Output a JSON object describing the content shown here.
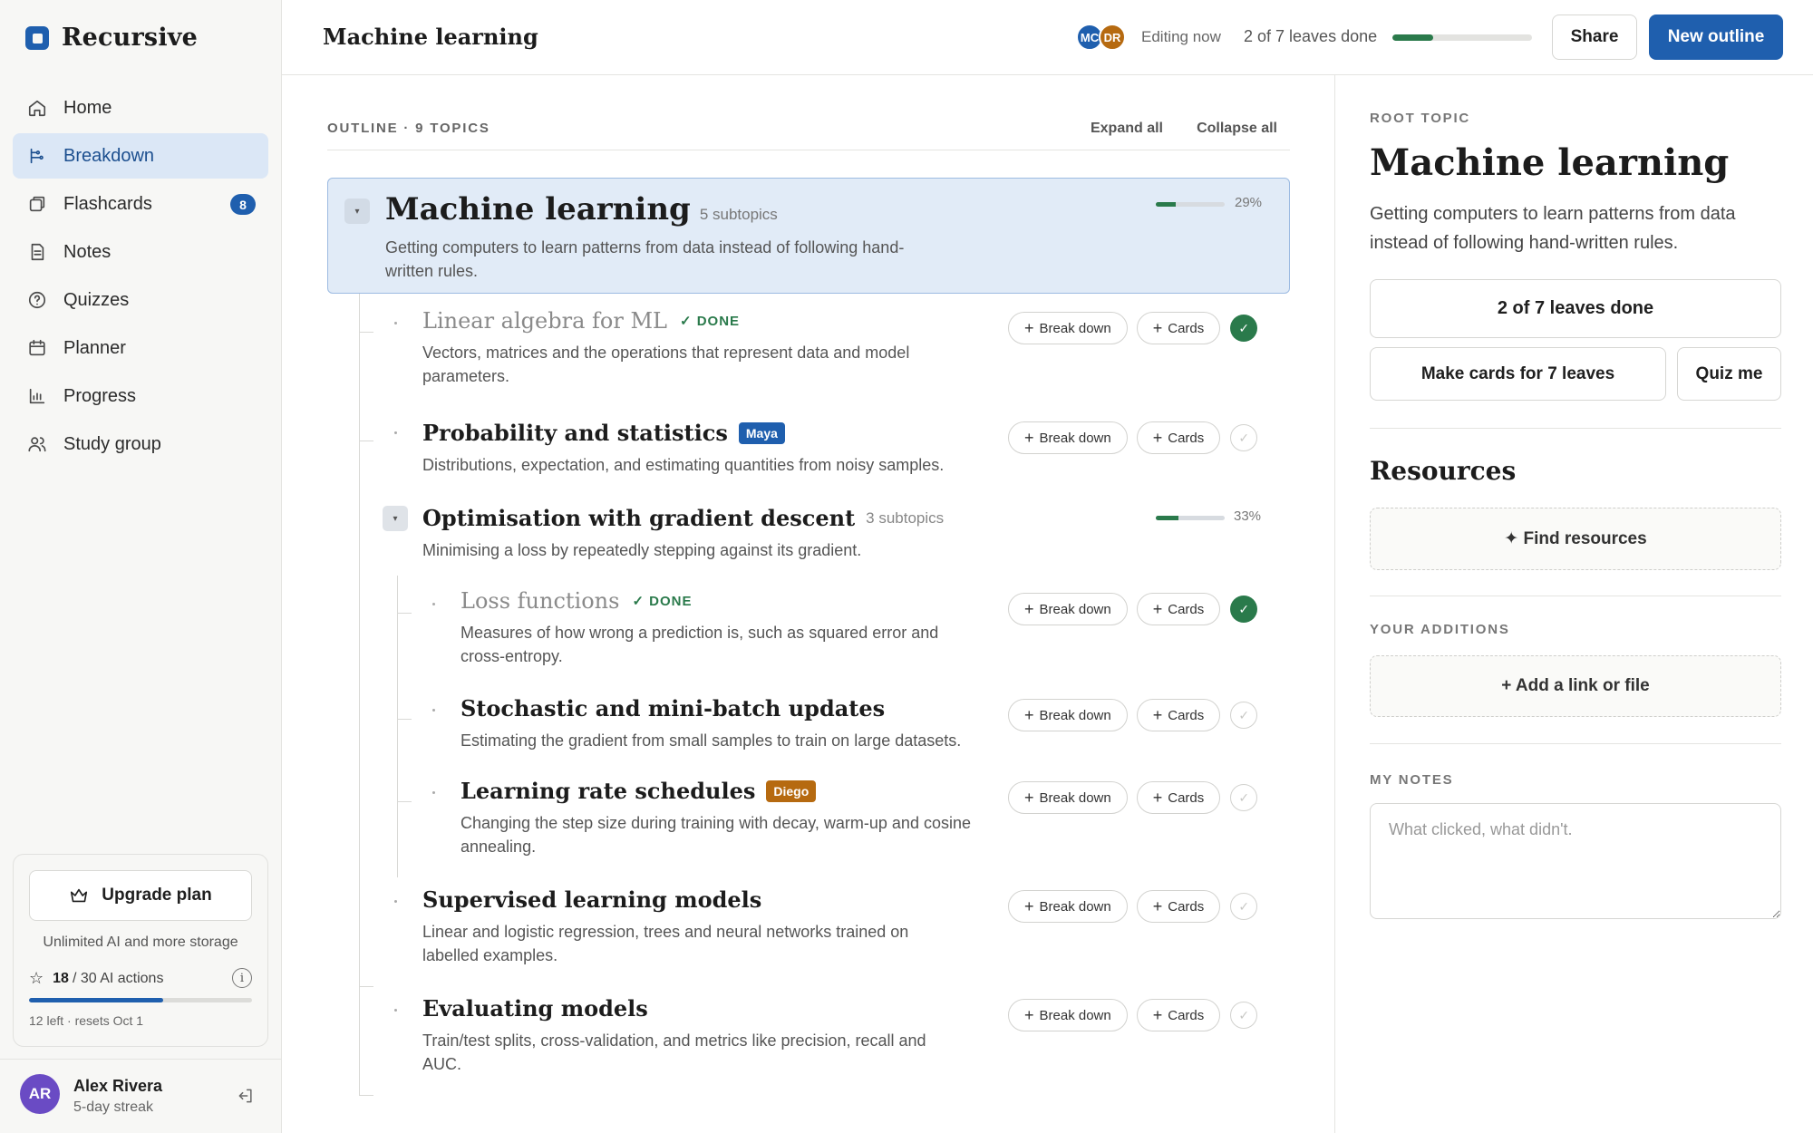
{
  "app": {
    "name": "Recursive"
  },
  "sidebar": {
    "items": [
      {
        "label": "Home",
        "icon": "home-icon"
      },
      {
        "label": "Breakdown",
        "icon": "breakdown-icon",
        "active": true
      },
      {
        "label": "Flashcards",
        "icon": "flashcards-icon",
        "badge": "8"
      },
      {
        "label": "Notes",
        "icon": "notes-icon"
      },
      {
        "label": "Quizzes",
        "icon": "quizzes-icon"
      },
      {
        "label": "Planner",
        "icon": "calendar-icon"
      },
      {
        "label": "Progress",
        "icon": "bar-chart-icon"
      },
      {
        "label": "Study group",
        "icon": "users-icon"
      }
    ],
    "upgrade": {
      "button_label": "Upgrade plan",
      "subtitle": "Unlimited AI and more storage",
      "ai_used": "18",
      "ai_total_text": "/ 30 AI actions",
      "ai_fraction": 0.6,
      "left_text": "12 left · resets Oct 1"
    },
    "user": {
      "initials": "AR",
      "name": "Alex Rivera",
      "streak": "5-day streak"
    }
  },
  "header": {
    "title": "Machine learning",
    "collaborators": [
      "MC",
      "DR"
    ],
    "editing_text": "Editing now",
    "leaves_done_text": "2 of 7 leaves done",
    "progress_fraction": 0.29,
    "share_label": "Share",
    "new_outline_label": "New outline"
  },
  "outline": {
    "label": "OUTLINE · 9 TOPICS",
    "expand_all": "Expand all",
    "collapse_all": "Collapse all",
    "break_down_label": "Break down",
    "cards_label": "Cards",
    "root": {
      "title": "Machine learning",
      "subcount": "5 subtopics",
      "desc": "Getting computers to learn patterns from data instead of following hand-written rules.",
      "pct": "29%",
      "fraction": 0.29
    },
    "nodes": {
      "linear": {
        "title": "Linear algebra for ML",
        "done_tag": "✓ DONE",
        "desc": "Vectors, matrices and the operations that represent data and model parameters."
      },
      "prob": {
        "title": "Probability and statistics",
        "tag": "Maya",
        "desc": "Distributions, expectation, and estimating quantities from noisy samples."
      },
      "optim": {
        "title": "Optimisation with gradient descent",
        "subcount": "3 subtopics",
        "desc": "Minimising a loss by repeatedly stepping against its gradient.",
        "pct": "33%",
        "fraction": 0.33
      },
      "loss": {
        "title": "Loss functions",
        "done_tag": "✓ DONE",
        "desc": "Measures of how wrong a prediction is, such as squared error and cross-entropy."
      },
      "stoch": {
        "title": "Stochastic and mini-batch updates",
        "desc": "Estimating the gradient from small samples to train on large datasets."
      },
      "lr": {
        "title": "Learning rate schedules",
        "tag": "Diego",
        "desc": "Changing the step size during training with decay, warm-up and cosine annealing."
      },
      "supervised": {
        "title": "Supervised learning models",
        "desc": "Linear and logistic regression, trees and neural networks trained on labelled examples."
      },
      "eval": {
        "title": "Evaluating models",
        "desc": "Train/test splits, cross-validation, and metrics like precision, recall and AUC."
      }
    }
  },
  "panel": {
    "root_label": "ROOT TOPIC",
    "title": "Machine learning",
    "desc": "Getting computers to learn patterns from data instead of following hand-written rules.",
    "leaves_button": "2 of 7 leaves done",
    "make_cards": "Make cards for 7 leaves",
    "quiz_me": "Quiz me",
    "resources_title": "Resources",
    "find_resources": "✦ Find resources",
    "your_additions": "YOUR ADDITIONS",
    "add_link": "+ Add a link or file",
    "my_notes": "MY NOTES",
    "notes_placeholder": "What clicked, what didn't."
  },
  "colors": {
    "accent": "#1f5fae",
    "done": "#2a7a4b",
    "maya": "#1f5fae",
    "diego": "#b66a10"
  }
}
